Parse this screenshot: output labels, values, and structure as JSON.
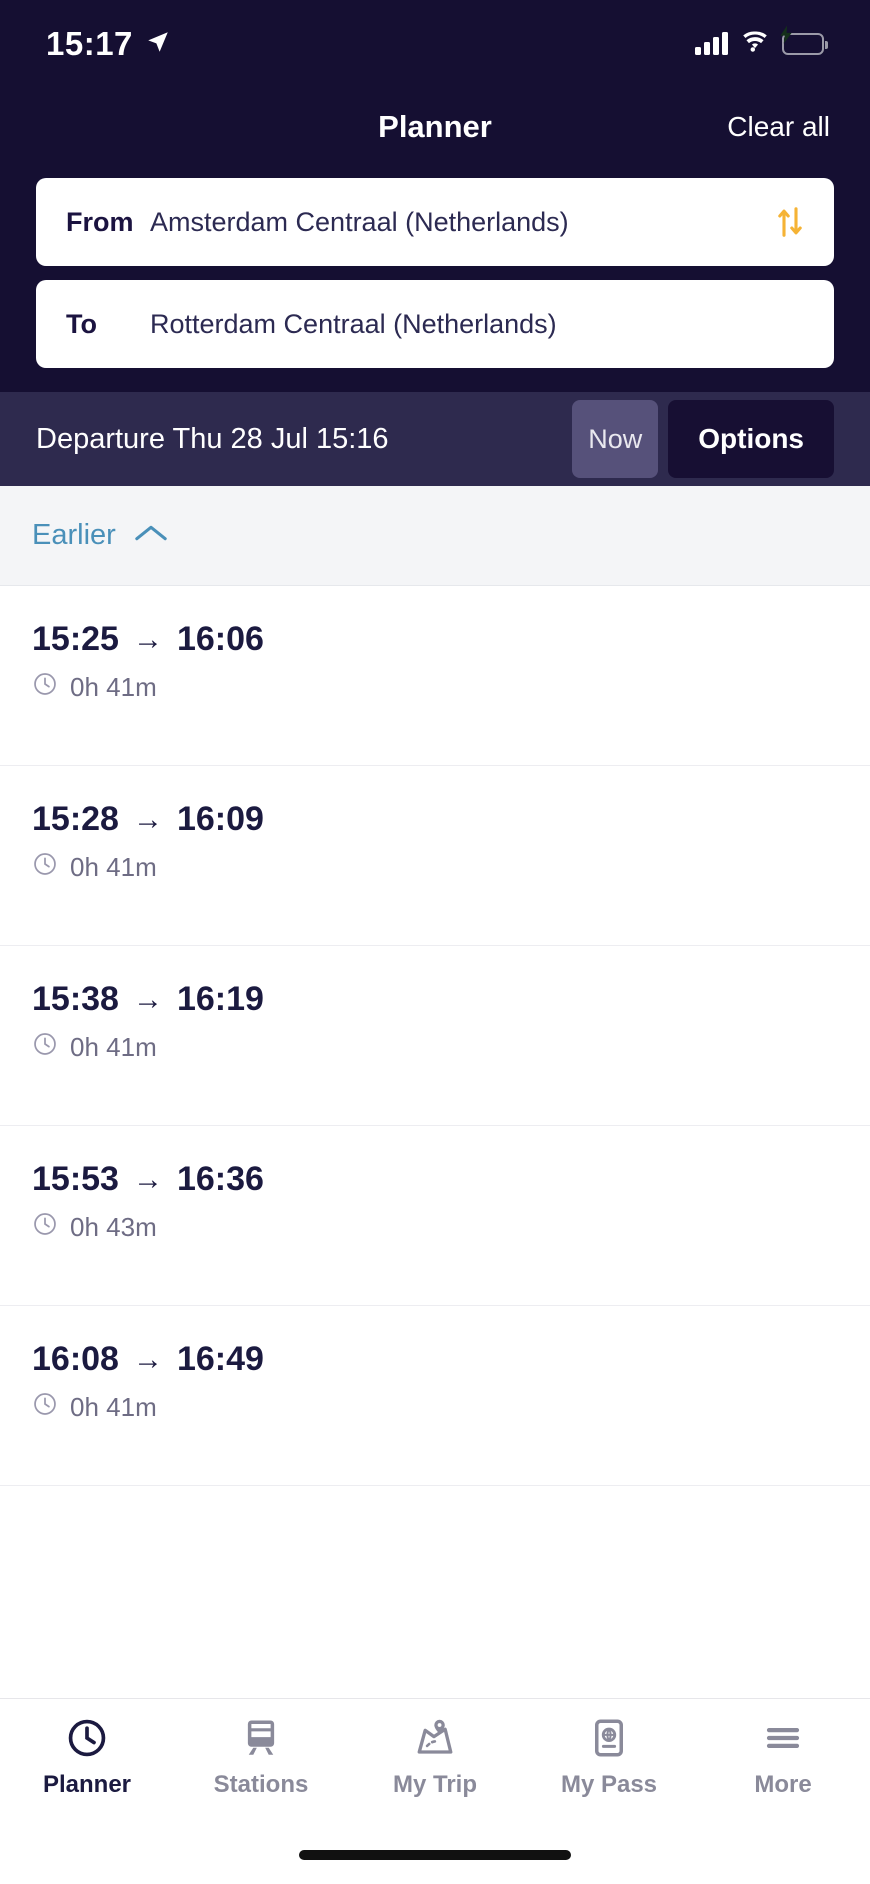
{
  "status_bar": {
    "time": "15:17",
    "location_icon": "location-arrow-icon",
    "signal_icon": "cellular-signal-icon",
    "wifi_icon": "wifi-icon",
    "battery_icon": "battery-charging-icon"
  },
  "header": {
    "title": "Planner",
    "clear_all_label": "Clear all",
    "from": {
      "label": "From",
      "value": "Amsterdam Centraal (Netherlands)"
    },
    "to": {
      "label": "To",
      "value": "Rotterdam Centraal (Netherlands)"
    },
    "swap_icon": "swap-vertical-arrows-icon"
  },
  "toolbar": {
    "departure_text": "Departure Thu 28 Jul 15:16",
    "now_label": "Now",
    "options_label": "Options"
  },
  "earlier": {
    "label": "Earlier",
    "chevron_icon": "chevron-up-icon"
  },
  "results": [
    {
      "depart": "15:25",
      "arrow": "→",
      "arrive": "16:06",
      "duration": "0h 41m",
      "clock_icon": "clock-icon"
    },
    {
      "depart": "15:28",
      "arrow": "→",
      "arrive": "16:09",
      "duration": "0h 41m",
      "clock_icon": "clock-icon"
    },
    {
      "depart": "15:38",
      "arrow": "→",
      "arrive": "16:19",
      "duration": "0h 41m",
      "clock_icon": "clock-icon"
    },
    {
      "depart": "15:53",
      "arrow": "→",
      "arrive": "16:36",
      "duration": "0h 43m",
      "clock_icon": "clock-icon"
    },
    {
      "depart": "16:08",
      "arrow": "→",
      "arrive": "16:49",
      "duration": "0h 41m",
      "clock_icon": "clock-icon"
    }
  ],
  "tabs": [
    {
      "label": "Planner",
      "icon": "clock-icon",
      "active": true
    },
    {
      "label": "Stations",
      "icon": "train-icon",
      "active": false
    },
    {
      "label": "My Trip",
      "icon": "map-pin-icon",
      "active": false
    },
    {
      "label": "My Pass",
      "icon": "passport-icon",
      "active": false
    },
    {
      "label": "More",
      "icon": "hamburger-menu-icon",
      "active": false
    }
  ],
  "colors": {
    "header_navy": "#150f32",
    "toolbar_navy": "#2e2a4e",
    "options_navy": "#170f33",
    "accent_amber": "#f5b335",
    "earlier_blue": "#4a90b9",
    "text_dark": "#1b1a40",
    "muted": "#6e6c84",
    "battery_green": "#6ddc6d"
  }
}
